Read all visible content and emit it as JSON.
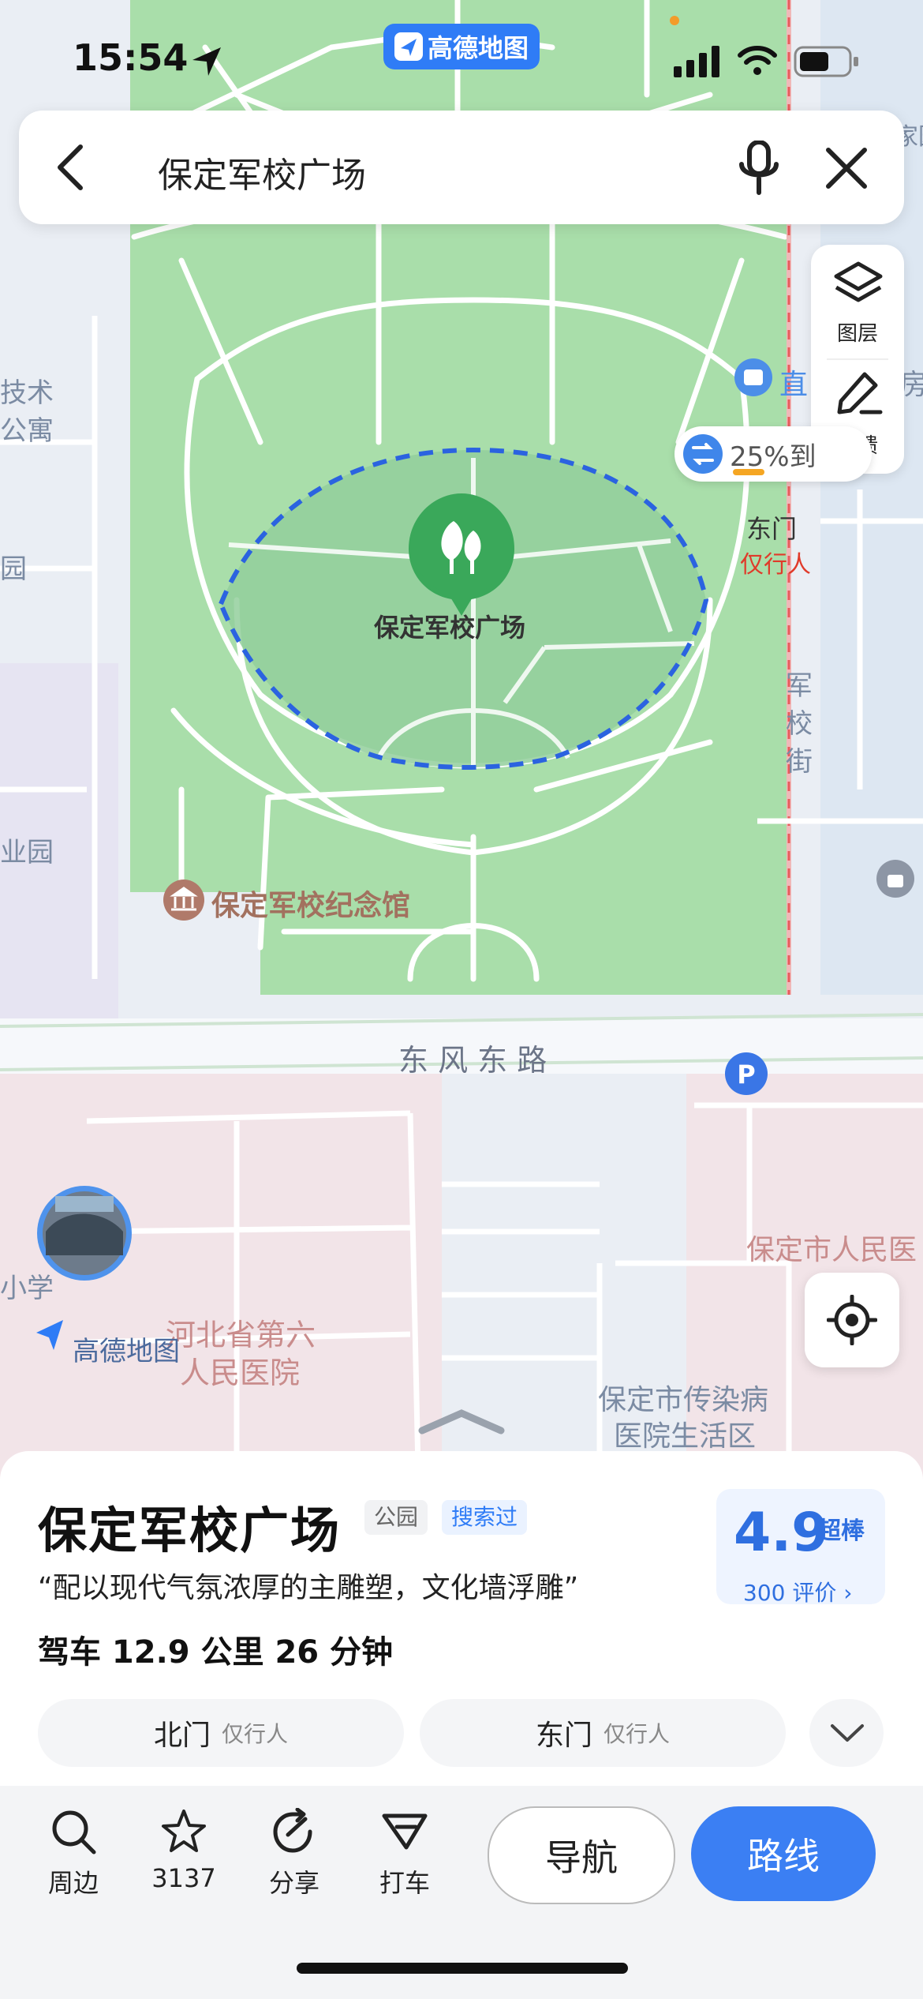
{
  "status_bar": {
    "time": "15:54",
    "app_badge": "高德地图"
  },
  "search": {
    "query": "保定军校广场"
  },
  "map_tools": {
    "layers_label": "图层",
    "feedback_label": "反馈"
  },
  "bus_chip": {
    "text": "25%到"
  },
  "map_labels": {
    "park_name": "保定军校广场",
    "east_gate": "东门",
    "east_gate_note": "仅行人",
    "street_vertical": "军校街",
    "road": "东 风 东 路",
    "memorial": "保定军校纪念馆",
    "left_apartment_1": "技术",
    "left_apartment_2": "公寓",
    "left_garden": "园",
    "left_industrial": "业园",
    "school": "小学",
    "hospital_1": "河北省第六",
    "hospital_2": "人民医院",
    "infectious_1": "保定市传染病",
    "infectious_2": "医院生活区",
    "city_hospital": "保定市人民医",
    "top_right_station": "直",
    "top_right_clipped": "房",
    "top_right_clipped2": "家园",
    "watermark": "高德地图"
  },
  "place": {
    "name": "保定军校广场",
    "category": "公园",
    "searched_tag": "搜索过",
    "quote": "“配以现代气氛浓厚的主雕塑，文化墙浮雕”",
    "drive": "驾车 12.9 公里   26 分钟",
    "rating": "4.9",
    "rating_word": "超棒",
    "review_count": "300 评价 ›"
  },
  "gates": [
    {
      "name": "北门",
      "note": "仅行人"
    },
    {
      "name": "东门",
      "note": "仅行人"
    }
  ],
  "actions": {
    "nearby": "周边",
    "favorite_count": "3137",
    "share": "分享",
    "taxi": "打车",
    "navigate": "导航",
    "route": "路线"
  },
  "colors": {
    "accent": "#2f7cf6",
    "park": "#a9deaa",
    "route_button": "#3b7ff3"
  }
}
